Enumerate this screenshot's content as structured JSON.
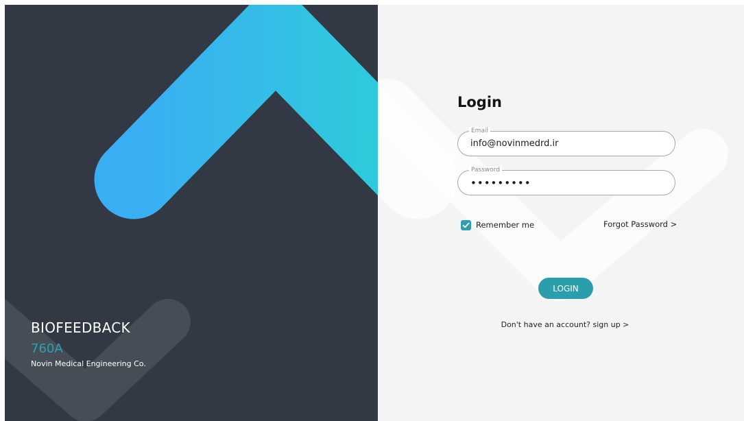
{
  "brand": {
    "title": "BIOFEEDBACK",
    "model": "760A",
    "company": "Novin Medical Engineering Co."
  },
  "login": {
    "title": "Login",
    "email": {
      "legend": "Email",
      "value": "info@novinmedrd.ir"
    },
    "password": {
      "legend": "Password",
      "value": "123456789"
    },
    "remember_label": "Remember me",
    "remember_checked": true,
    "forgot_label": "Forgot Password >",
    "button_label": "LOGIN",
    "signup_prompt": "Don't have an account?",
    "signup_link": "sign up >"
  },
  "colors": {
    "left_background": "#323944",
    "right_background": "#f4f4f4",
    "accent": "#2a9fab",
    "gradient_start": "#3aaef3",
    "gradient_end": "#2ccfd7",
    "model_text": "#2aa3ad"
  },
  "icons": {
    "checkbox": "check-icon"
  }
}
